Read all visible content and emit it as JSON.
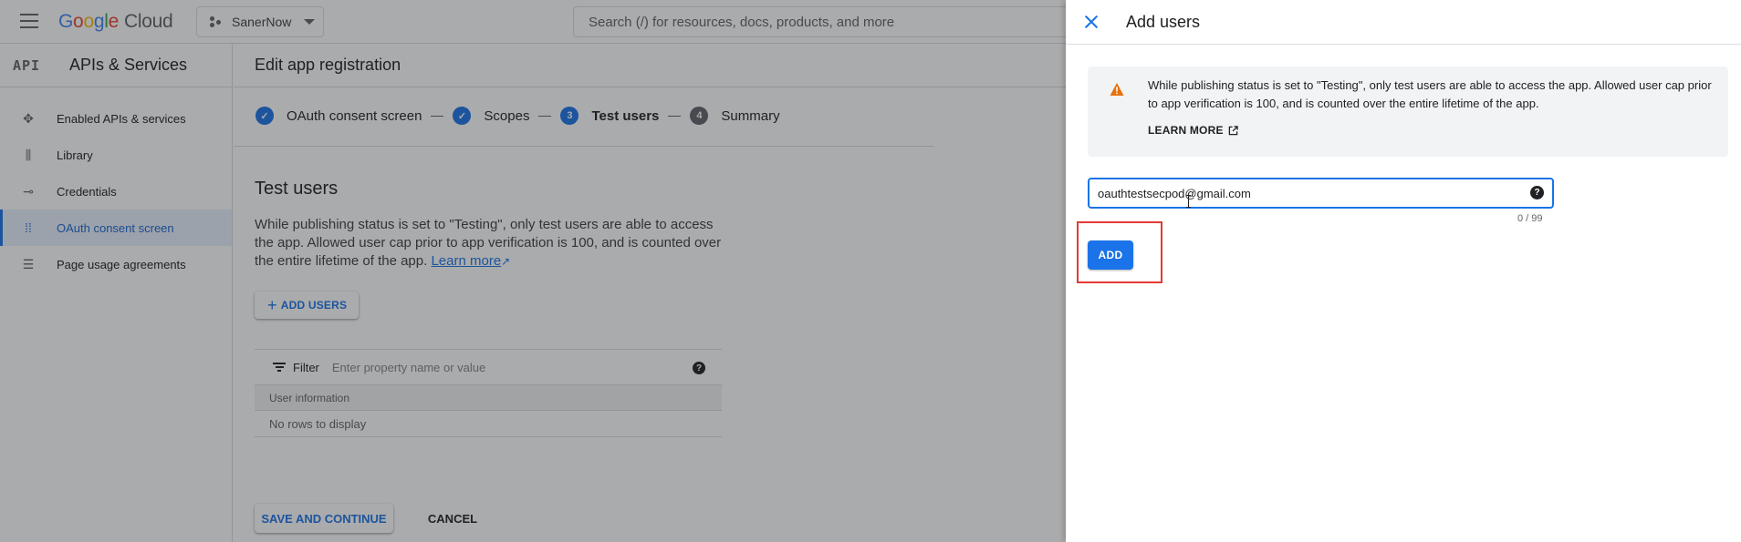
{
  "topbar": {
    "logo_google": "Google",
    "logo_cloud": "Cloud",
    "project": "SanerNow",
    "search_placeholder": "Search (/) for resources, docs, products, and more"
  },
  "sidebar": {
    "badge": "API",
    "title": "APIs & Services",
    "items": [
      {
        "label": "Enabled APIs & services",
        "icon": "diamond-nodes-icon"
      },
      {
        "label": "Library",
        "icon": "library-icon"
      },
      {
        "label": "Credentials",
        "icon": "key-icon"
      },
      {
        "label": "OAuth consent screen",
        "icon": "dots-grid-icon",
        "active": true
      },
      {
        "label": "Page usage agreements",
        "icon": "settings-list-icon"
      }
    ]
  },
  "main": {
    "header": "Edit app registration",
    "steps": [
      {
        "label": "OAuth consent screen",
        "state": "done"
      },
      {
        "label": "Scopes",
        "state": "done"
      },
      {
        "num": "3",
        "label": "Test users",
        "state": "current"
      },
      {
        "num": "4",
        "label": "Summary",
        "state": "pending"
      }
    ],
    "section_title": "Test users",
    "section_desc": "While publishing status is set to \"Testing\", only test users are able to access the app. Allowed user cap prior to app verification is 100, and is counted over the entire lifetime of the app.",
    "learn_more": "Learn more",
    "add_users": "ADD USERS",
    "filter_label": "Filter",
    "filter_placeholder": "Enter property name or value",
    "column_header": "User information",
    "empty_text": "No rows to display",
    "save_continue": "SAVE AND CONTINUE",
    "cancel": "CANCEL"
  },
  "panel": {
    "title": "Add users",
    "notice": "While publishing status is set to \"Testing\", only test users are able to access the app. Allowed user cap prior to app verification is 100, and is counted over the entire lifetime of the app.",
    "learn_more": "LEARN MORE",
    "email_value": "oauthtestsecpod@gmail.com",
    "counter": "0 / 99",
    "add_button": "ADD"
  },
  "colors": {
    "accent": "#1a73e8",
    "warning": "#e8710a",
    "highlight": "#e53935"
  }
}
